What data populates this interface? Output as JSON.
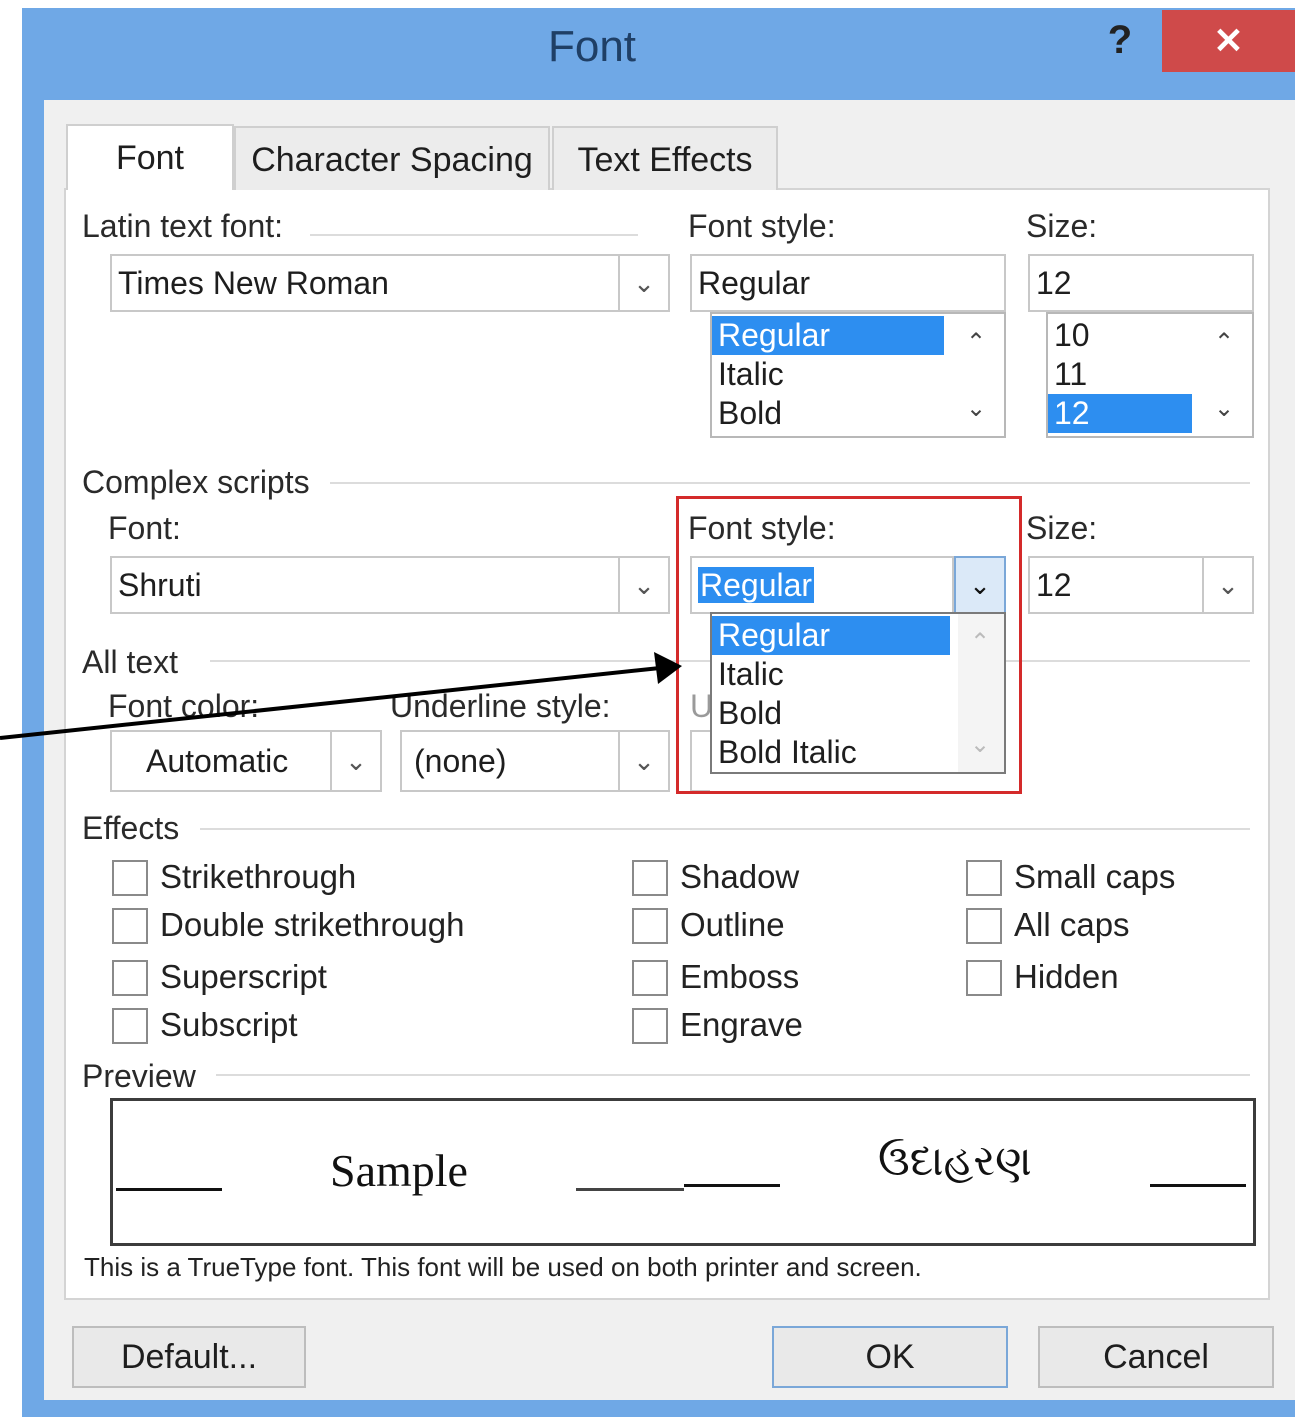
{
  "window": {
    "title": "Font",
    "help_label": "?",
    "close_label": "✕"
  },
  "tabs": [
    {
      "label": "Font"
    },
    {
      "label": "Character Spacing"
    },
    {
      "label": "Text Effects"
    }
  ],
  "latin": {
    "font_label": "Latin text font:",
    "font_value": "Times New Roman",
    "style_label": "Font style:",
    "style_value": "Regular",
    "style_items": [
      "Regular",
      "Italic",
      "Bold"
    ],
    "size_label": "Size:",
    "size_value": "12",
    "size_items": [
      "10",
      "11",
      "12"
    ]
  },
  "complex": {
    "section_label": "Complex scripts",
    "font_label": "Font:",
    "font_value": "Shruti",
    "style_label": "Font style:",
    "style_value": "Regular",
    "style_dropdown_items": [
      "Regular",
      "Italic",
      "Bold",
      "Bold Italic"
    ],
    "size_label": "Size:",
    "size_value": "12"
  },
  "all_text": {
    "section_label": "All text",
    "color_label": "Font color:",
    "color_value": "Automatic",
    "underline_label": "Underline style:",
    "underline_value": "(none)",
    "underline_color_stub": "U"
  },
  "effects": {
    "section_label": "Effects",
    "col1": [
      "Strikethrough",
      "Double strikethrough",
      "Superscript",
      "Subscript"
    ],
    "col2": [
      "Shadow",
      "Outline",
      "Emboss",
      "Engrave"
    ],
    "col3": [
      "Small caps",
      "All caps",
      "Hidden"
    ]
  },
  "preview": {
    "section_label": "Preview",
    "sample_text": "Sample",
    "complex_sample": "ઉદાહરણ",
    "info": "This is a TrueType font. This font will be used on both printer and screen."
  },
  "buttons": {
    "default": "Default...",
    "ok": "OK",
    "cancel": "Cancel"
  },
  "colors": {
    "title_bar": "#6fa8e6",
    "close": "#cf4a4a",
    "selection": "#2d8ef0",
    "highlight_box": "#d42a2a"
  },
  "icons": {
    "dropdown": "chevron-down-icon",
    "scroll_up": "chevron-up-icon",
    "scroll_down": "chevron-down-icon"
  }
}
